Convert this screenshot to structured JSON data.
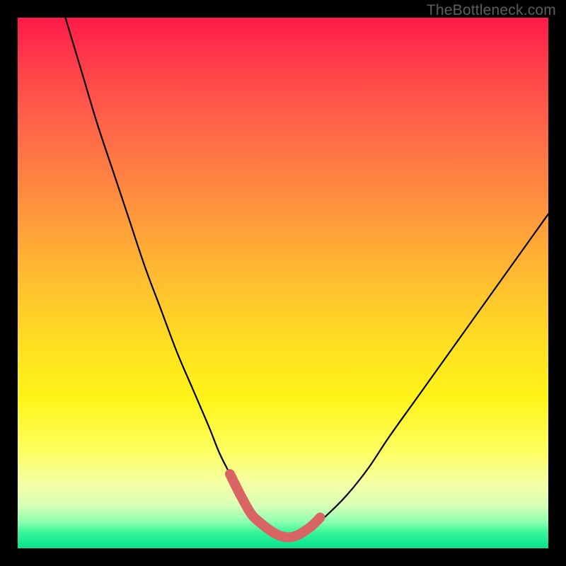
{
  "watermark": "TheBottleneck.com",
  "chart_data": {
    "type": "line",
    "title": "",
    "xlabel": "",
    "ylabel": "",
    "xlim": [
      0,
      100
    ],
    "ylim": [
      0,
      100
    ],
    "series": [
      {
        "name": "bottleneck-curve",
        "x": [
          9,
          12,
          15,
          18,
          21,
          24,
          27,
          30,
          33,
          36,
          38,
          40,
          42,
          44,
          46,
          48,
          50,
          52,
          55,
          58,
          62,
          66,
          70,
          75,
          80,
          85,
          90,
          95,
          100
        ],
        "values": [
          100,
          90,
          80,
          71,
          62,
          53,
          45,
          37,
          30,
          23,
          18,
          14,
          10,
          6.5,
          4,
          2.5,
          2,
          2.3,
          3.5,
          6,
          10,
          15,
          21,
          28,
          35,
          42,
          49,
          56,
          63
        ]
      }
    ],
    "highlight": {
      "name": "low-bottleneck-band",
      "color": "#d86464",
      "x": [
        40,
        42,
        44,
        45.5,
        47,
        48.5,
        50,
        51.5,
        53,
        54,
        55.5,
        57
      ],
      "values": [
        14,
        10,
        6.5,
        5,
        3.8,
        2.8,
        2.2,
        2.1,
        2.6,
        3.2,
        4.3,
        5.8
      ]
    },
    "background_gradient": {
      "stops": [
        {
          "pos": 0.0,
          "color": "#ff1a49"
        },
        {
          "pos": 0.5,
          "color": "#ffbf30"
        },
        {
          "pos": 0.82,
          "color": "#fdff63"
        },
        {
          "pos": 1.0,
          "color": "#0edc88"
        }
      ]
    }
  }
}
